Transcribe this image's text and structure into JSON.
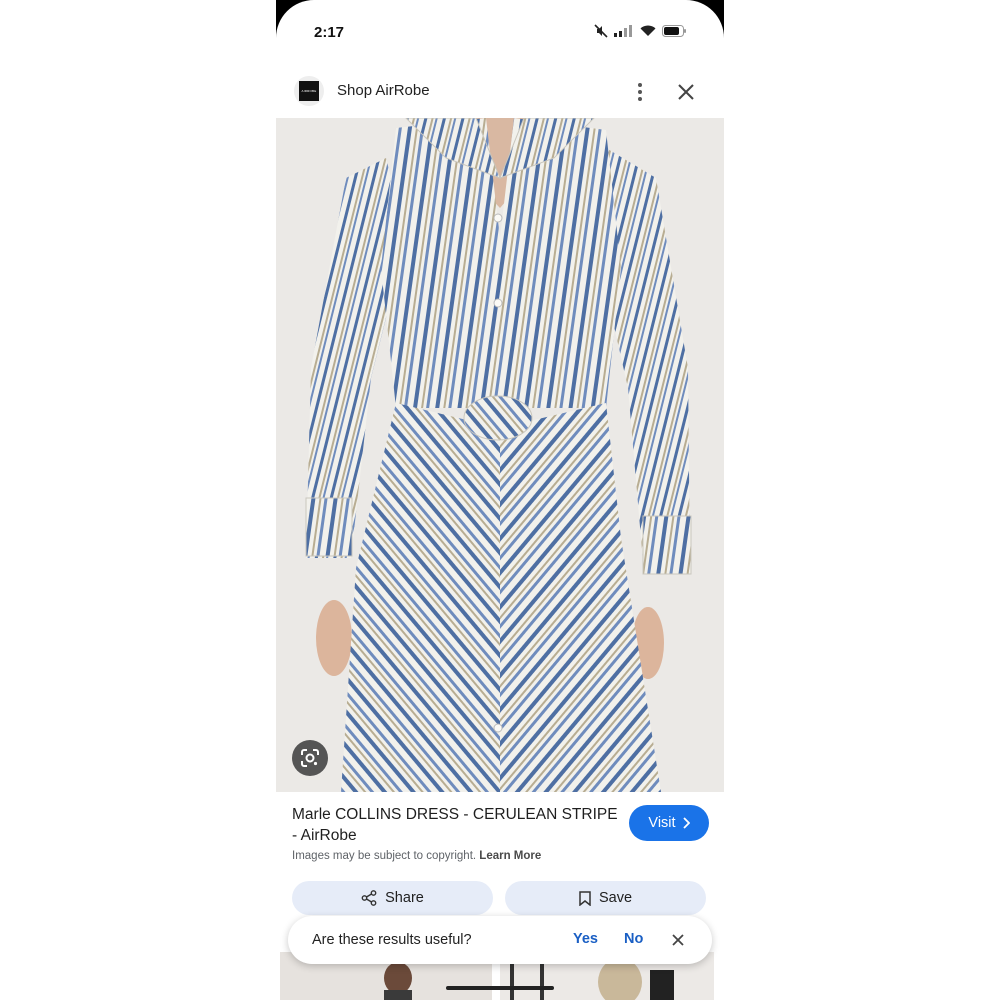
{
  "status_bar": {
    "time": "2:17",
    "icons": [
      "mute-icon",
      "signal-icon",
      "wifi-icon",
      "battery-icon"
    ]
  },
  "header": {
    "logo_text": "AIRROBE",
    "site_name": "Shop AirRobe",
    "icons": [
      "more-vert-icon",
      "close-icon"
    ]
  },
  "product": {
    "image_description_icon": "google-lens-icon",
    "title": "Marle COLLINS DRESS - CERULEAN STRIPE - AirRobe",
    "visit_label": "Visit",
    "copyright_text": "Images may be subject to copyright.",
    "learn_more_label": "Learn More"
  },
  "actions": {
    "share_label": "Share",
    "save_label": "Save"
  },
  "feedback": {
    "question": "Are these results useful?",
    "yes_label": "Yes",
    "no_label": "No"
  },
  "colors": {
    "accent": "#1a73e8",
    "action_button_bg": "#e6ecf8",
    "stripe_blue": "#4e6fa3",
    "stripe_khaki": "#b8ad92"
  }
}
